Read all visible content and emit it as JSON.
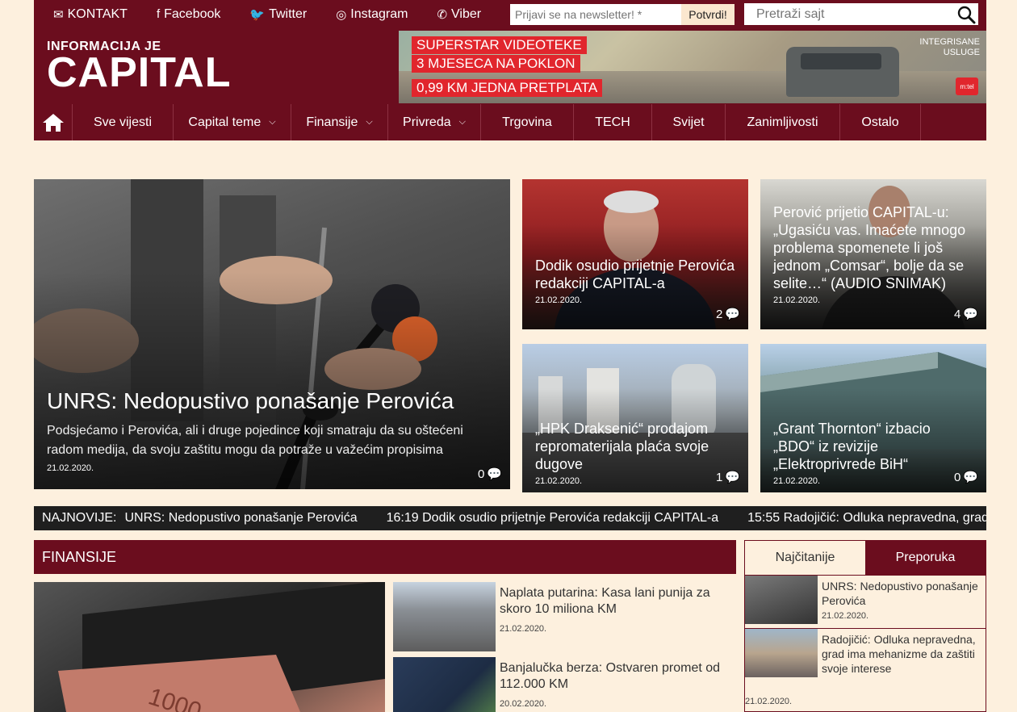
{
  "topbar": {
    "links": [
      {
        "icon": "envelope-icon",
        "glyph": "✉",
        "label": "KONTAKT"
      },
      {
        "icon": "facebook-icon",
        "glyph": "f",
        "label": "Facebook"
      },
      {
        "icon": "twitter-icon",
        "glyph": "🐦",
        "label": "Twitter"
      },
      {
        "icon": "instagram-icon",
        "glyph": "◎",
        "label": "Instagram"
      },
      {
        "icon": "viber-icon",
        "glyph": "✆",
        "label": "Viber"
      }
    ],
    "newsletter_placeholder": "Prijavi se na newsletter! *",
    "newsletter_button": "Potvrdi!",
    "search_placeholder": "Pretraži sajt"
  },
  "header": {
    "logo_small": "INFORMACIJA JE",
    "logo_big": "CAPITAL",
    "ad": {
      "line1": "SUPERSTAR VIDEOTEKE",
      "line2": "3 MJESECA NA POKLON",
      "line3": "0,99 KM JEDNA PRETPLATA",
      "corner": "INTEGRISANE\nUSLUGE",
      "brand": "m:tel"
    }
  },
  "nav": {
    "items": [
      {
        "label": "Sve vijesti",
        "dropdown": false
      },
      {
        "label": "Capital teme",
        "dropdown": true
      },
      {
        "label": "Finansije",
        "dropdown": true
      },
      {
        "label": "Privreda",
        "dropdown": true
      },
      {
        "label": "Trgovina",
        "dropdown": false
      },
      {
        "label": "TECH",
        "dropdown": false
      },
      {
        "label": "Svijet",
        "dropdown": false
      },
      {
        "label": "Zanimljivosti",
        "dropdown": false
      },
      {
        "label": "Ostalo",
        "dropdown": false
      }
    ]
  },
  "hero": {
    "main": {
      "title": "UNRS: Nedopustivo ponašanje Perovića",
      "subtitle": "Podsjećamo i Perovića, ali i druge pojedince koji smatraju da su oštećeni radom medija, da svoju zaštitu mogu da potraže u važećim propisima",
      "date": "21.02.2020.",
      "comments": "0"
    },
    "tiles": [
      {
        "title": "Dodik osudio prijetnje Perovića redakciji CAPITAL-a",
        "date": "21.02.2020.",
        "comments": "2"
      },
      {
        "title": "Perović prijetio CAPITAL-u: „Ugasiću vas. Imaćete mnogo problema spomenete li još jednom „Comsar“, bolje da se selite…“ (AUDIO SNIMAK)",
        "date": "21.02.2020.",
        "comments": "4"
      },
      {
        "title": "„HPK Draksenić“ prodajom repromaterijala plaća svoje dugove",
        "date": "21.02.2020.",
        "comments": "1"
      },
      {
        "title": "„Grant Thornton“ izbacio „BDO“ iz revizije „Elektroprivrede BiH“",
        "date": "21.02.2020.",
        "comments": "0"
      }
    ]
  },
  "ticker": {
    "label": "NAJNOVIJE:",
    "items": [
      "UNRS: Nedopustivo ponašanje Perovića",
      "16:19 Dodik osudio prijetnje Perovića redakciji CAPITAL-a",
      "15:55 Radojičić: Odluka nepravedna, grad"
    ]
  },
  "finansije": {
    "heading": "FINANSIJE",
    "items": [
      {
        "title": "Naplata putarina: Kasa lani punija za skoro 10 miliona KM",
        "date": "21.02.2020."
      },
      {
        "title": "Banjalučka berza: Ostvaren promet od 112.000 KM",
        "date": "20.02.2020."
      }
    ]
  },
  "sidebar": {
    "tabs": [
      "Najčitanije",
      "Preporuka"
    ],
    "items": [
      {
        "title": "UNRS: Nedopustivo ponašanje Perovića",
        "date": "21.02.2020."
      },
      {
        "title": "Radojičić: Odluka nepravedna, grad ima mehanizme da zaštiti svoje interese",
        "date": "21.02.2020."
      }
    ]
  },
  "colors": {
    "brand": "#6b0d1e",
    "background": "#fdf0de",
    "ticker": "#1f1f1f",
    "ad_red": "#e1262d"
  }
}
